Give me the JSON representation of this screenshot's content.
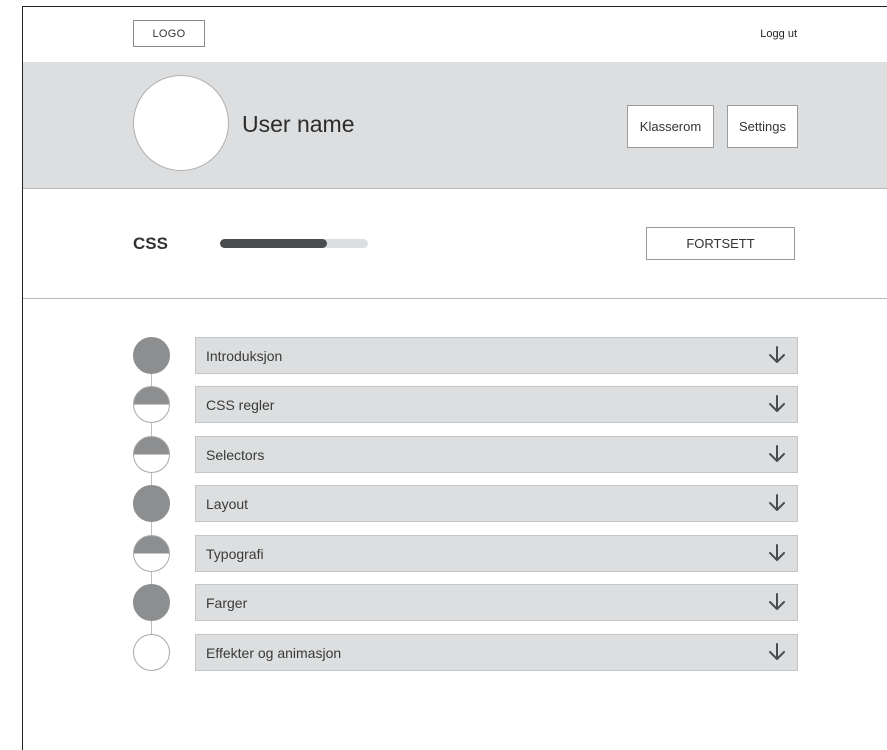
{
  "header": {
    "logo": "LOGO",
    "logout": "Logg ut"
  },
  "profile": {
    "username": "User name",
    "buttons": {
      "classroom": "Klasserom",
      "settings": "Settings"
    }
  },
  "course": {
    "name": "CSS",
    "progress": 0.72,
    "continue_label": "FORTSETT"
  },
  "lessons": [
    {
      "title": "Introduksjon",
      "status": "full"
    },
    {
      "title": "CSS regler",
      "status": "half"
    },
    {
      "title": "Selectors",
      "status": "half"
    },
    {
      "title": "Layout",
      "status": "full"
    },
    {
      "title": "Typografi",
      "status": "half"
    },
    {
      "title": "Farger",
      "status": "full"
    },
    {
      "title": "Effekter og animasjon",
      "status": "empty"
    }
  ],
  "icons": {
    "expand": "arrow-down-icon"
  },
  "colors": {
    "hero_bg": "#dcdedf",
    "progress_fill": "#4a4d4f",
    "dot_fill": "#8c8e8f"
  }
}
